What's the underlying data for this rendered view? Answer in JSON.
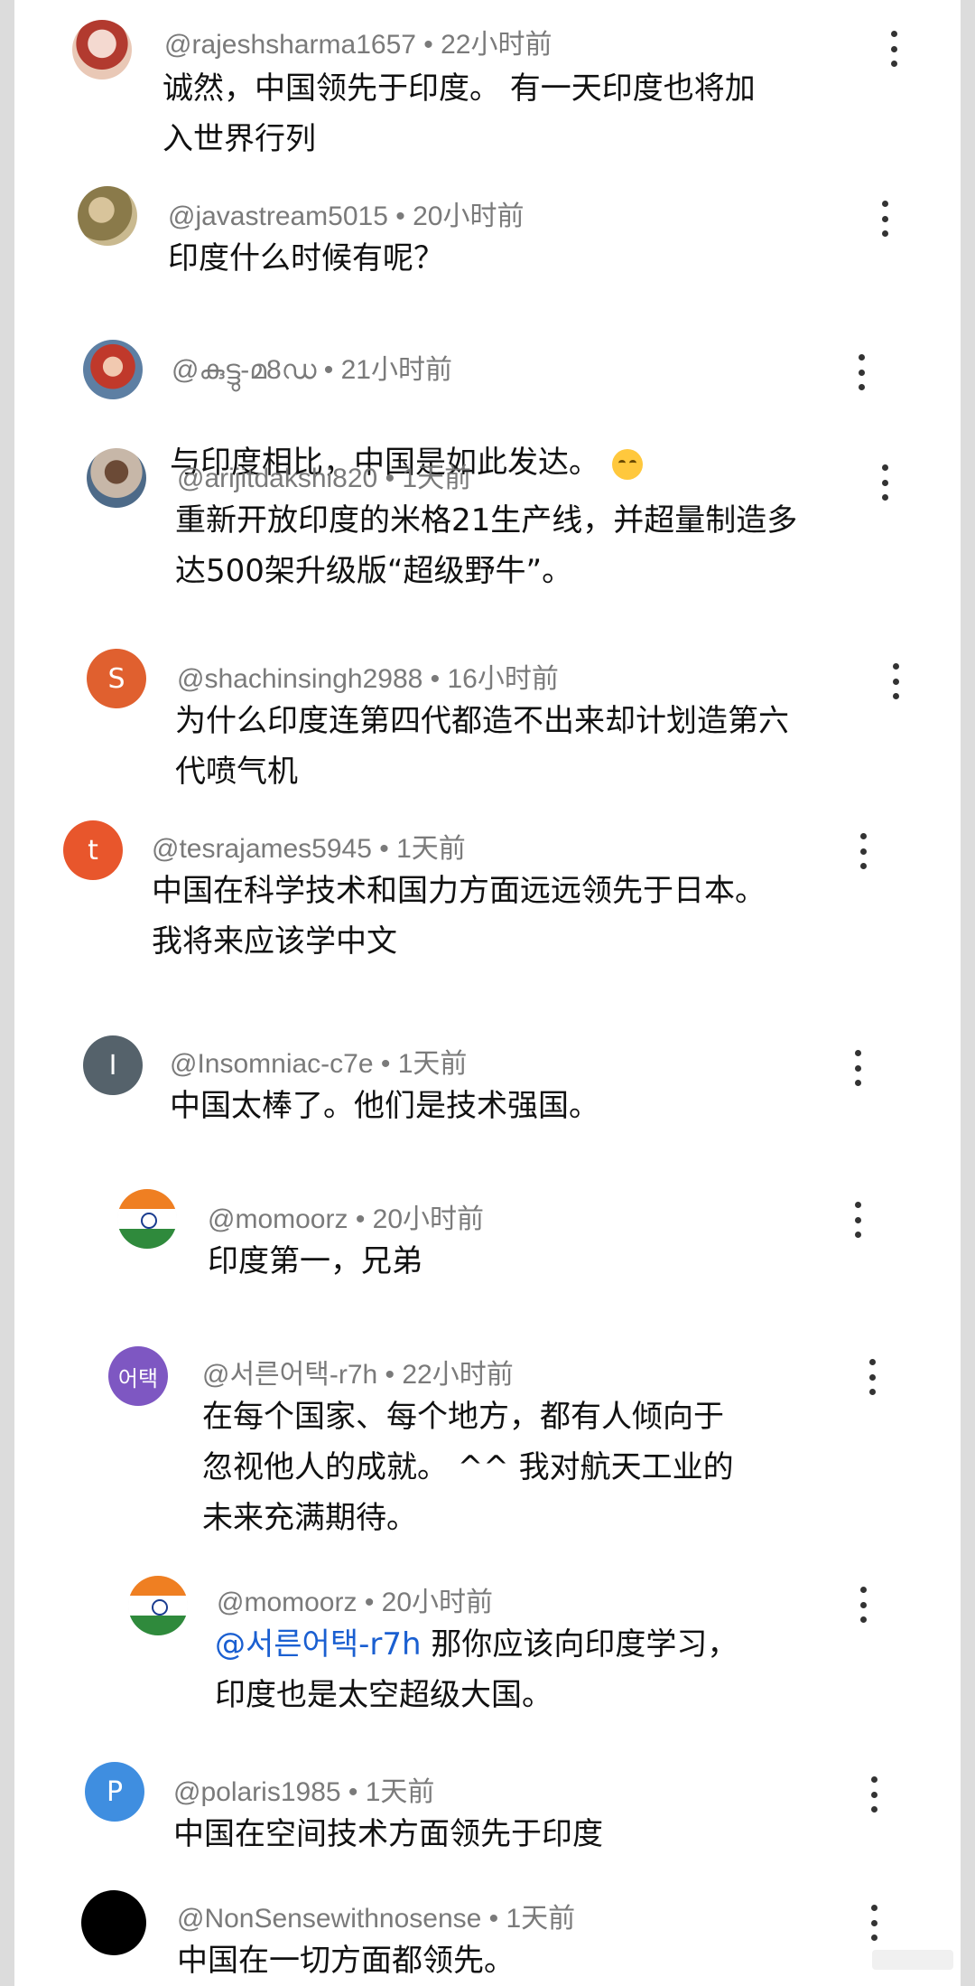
{
  "comments": [
    {
      "id": "c1",
      "handle": "@rajeshsharma1657 • 22小时前",
      "text": "诚然，中国领先于印度。  有一天印度也将加\n入世界行列",
      "avatar": "photo"
    },
    {
      "id": "c2",
      "handle": "@javastream5015 • 20小时前",
      "text": "印度什么时候有呢？",
      "avatar": "photo"
    },
    {
      "id": "c3",
      "handle": "@കുട്ടു-മ8ഡ • 21小时前",
      "text": "与印度相比，中国是如此发达。",
      "avatar": "photo",
      "emoji": "smiling-face"
    },
    {
      "id": "c4",
      "handle": "@arijitdakshi820 • 1天前",
      "text": "重新开放印度的米格21生产线，并超量制造多\n达500架升级版“超级野牛”。",
      "avatar": "photo"
    },
    {
      "id": "c5",
      "handle": "@shachinsingh2988 • 16小时前",
      "text": "为什么印度连第四代都造不出来却计划造第六\n代喷气机",
      "avatar_letter": "S",
      "avatar_color": "#e0602f"
    },
    {
      "id": "c6",
      "handle": "@tesrajames5945 • 1天前",
      "text": "中国在科学技术和国力方面远远领先于日本。\n我将来应该学中文",
      "avatar_letter": "t",
      "avatar_color": "#e8562c"
    },
    {
      "id": "c7",
      "handle": "@Insomniac-c7e • 1天前",
      "text": "中国太棒了。他们是技术强国。",
      "avatar_letter": "I",
      "avatar_color": "#55626b"
    },
    {
      "id": "c8",
      "handle": "@momoorz • 20小时前",
      "text": "印度第一，兄弟",
      "avatar": "india-flag"
    },
    {
      "id": "c9",
      "handle": "@서른어택-r7h • 22小时前",
      "text": "在每个国家、每个地方，都有人倾向于\n忽视他人的成就。 ^^ 我对航天工业的\n未来充满期待。",
      "avatar_letter": "어택",
      "avatar_color": "#7e57c2"
    },
    {
      "id": "c10",
      "handle": "@momoorz • 20小时前",
      "mention": "@서른어택-r7h",
      "text": " 那你应该向印度学习，\n印度也是太空超级大国。",
      "avatar": "india-flag"
    },
    {
      "id": "c11",
      "handle": "@polaris1985 • 1天前",
      "text": "中国在空间技术方面领先于印度",
      "avatar_letter": "P",
      "avatar_color": "#3f8ee0"
    },
    {
      "id": "c12",
      "handle": "@NonSensewithnosense • 1天前",
      "text": "中国在一切方面都领先。",
      "avatar_letter": "",
      "avatar_color": "#000000"
    }
  ],
  "icons": {
    "more": "more-vertical-icon"
  }
}
